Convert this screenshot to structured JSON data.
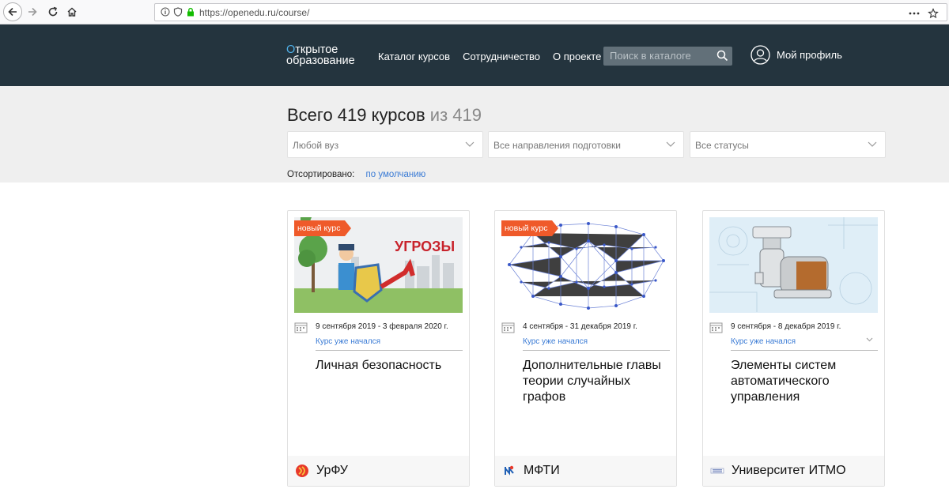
{
  "browser": {
    "url": "https://openedu.ru/course/"
  },
  "header": {
    "logo_line1": "ткрытое",
    "logo_first": "О",
    "logo_line2": "образование",
    "nav": [
      "Каталог курсов",
      "Сотрудничество",
      "О проекте"
    ],
    "search_placeholder": "Поиск в каталоге",
    "profile_label": "Мой профиль"
  },
  "filters": {
    "heading_main": "Всего 419 курсов",
    "heading_muted": "из 419",
    "university": "Любой вуз",
    "direction": "Все направления подготовки",
    "status": "Все статусы",
    "sort_label": "Отсортировано:",
    "sort_value": "по умолчанию"
  },
  "courses": [
    {
      "badge": "новый курс",
      "dates": "9 сентября 2019 - 3 февраля 2020 г.",
      "status": "Курс уже начался",
      "title": "Личная безопасность",
      "image_text": "УГРОЗЫ",
      "university": "УрФУ"
    },
    {
      "badge": "новый курс",
      "dates": "4 сентября - 31 декабря 2019 г.",
      "status": "Курс уже начался",
      "title": "Дополнительные главы теории случайных графов",
      "university": "МФТИ"
    },
    {
      "dates": "9 сентября - 8 декабря 2019 г.",
      "status": "Курс уже начался",
      "title": "Элементы систем автоматического управления",
      "university": "Университет ИТМО"
    }
  ],
  "colors": {
    "header_bg": "#24343e",
    "accent_blue": "#3a7bd5",
    "badge_orange": "#ef5a2a"
  }
}
